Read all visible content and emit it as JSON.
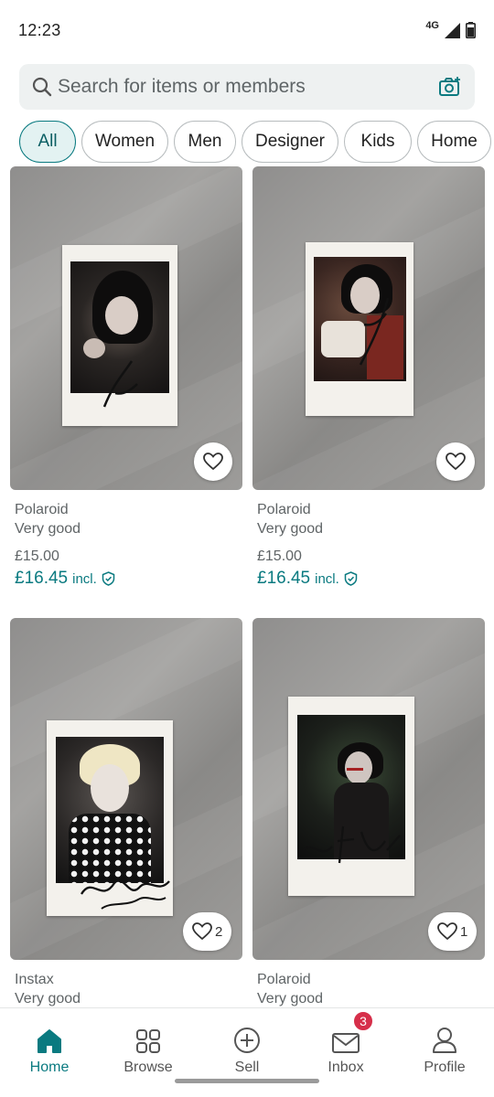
{
  "status_bar": {
    "time": "12:23",
    "network": "4G"
  },
  "search": {
    "placeholder": "Search for items or members"
  },
  "categories": [
    "All",
    "Women",
    "Men",
    "Designer",
    "Kids",
    "Home"
  ],
  "listings": [
    {
      "title": "Polaroid",
      "condition": "Very good",
      "price": "£15.00",
      "price_incl": "£16.45",
      "incl_label": "incl.",
      "likes": ""
    },
    {
      "title": "Polaroid",
      "condition": "Very good",
      "price": "£15.00",
      "price_incl": "£16.45",
      "incl_label": "incl.",
      "likes": ""
    },
    {
      "title": "Instax",
      "condition": "Very good",
      "likes": "2"
    },
    {
      "title": "Polaroid",
      "condition": "Very good",
      "likes": "1"
    }
  ],
  "nav": [
    {
      "label": "Home",
      "icon": "home-icon",
      "active": true
    },
    {
      "label": "Browse",
      "icon": "grid-icon"
    },
    {
      "label": "Sell",
      "icon": "plus-circle-icon"
    },
    {
      "label": "Inbox",
      "icon": "mail-icon",
      "badge": "3"
    },
    {
      "label": "Profile",
      "icon": "person-icon"
    }
  ],
  "colors": {
    "accent": "#0a7a80",
    "chip_active_bg": "#e3f2f2",
    "badge": "#d62f4a",
    "search_bg": "#eef1f1"
  }
}
